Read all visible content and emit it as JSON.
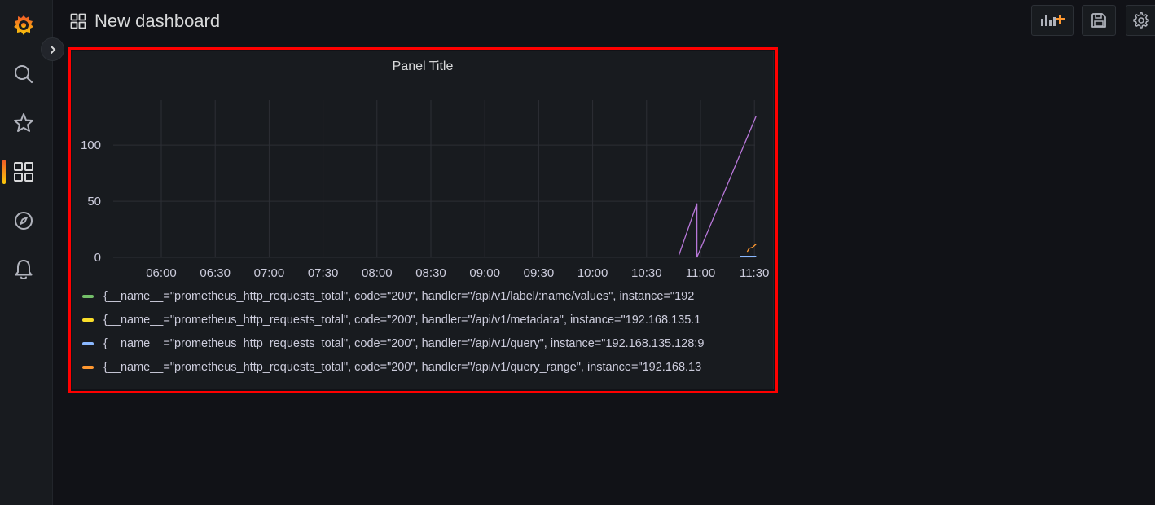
{
  "header": {
    "title": "New dashboard"
  },
  "sidebar": {
    "items": [
      {
        "name": "grafana-logo"
      },
      {
        "name": "search-icon"
      },
      {
        "name": "star-icon"
      },
      {
        "name": "dashboards-icon",
        "active": true
      },
      {
        "name": "explore-icon"
      },
      {
        "name": "alerting-icon"
      }
    ]
  },
  "toolbar": {
    "buttons": [
      "add-panel-icon",
      "save-icon",
      "settings-icon"
    ]
  },
  "colors": {
    "accent": "#f05a28",
    "highlight": "#ff0000",
    "series_purple": "#b877d9",
    "series_green": "#73bf69",
    "series_yellow": "#fade2a",
    "series_blue": "#8ab8ff",
    "series_orange": "#ff9830"
  },
  "panel": {
    "title": "Panel Title",
    "legend": [
      {
        "color": "#73bf69",
        "label": "{__name__=\"prometheus_http_requests_total\", code=\"200\", handler=\"/api/v1/label/:name/values\", instance=\"192"
      },
      {
        "color": "#fade2a",
        "label": "{__name__=\"prometheus_http_requests_total\", code=\"200\", handler=\"/api/v1/metadata\", instance=\"192.168.135.1"
      },
      {
        "color": "#8ab8ff",
        "label": "{__name__=\"prometheus_http_requests_total\", code=\"200\", handler=\"/api/v1/query\", instance=\"192.168.135.128:9"
      },
      {
        "color": "#ff9830",
        "label": "{__name__=\"prometheus_http_requests_total\", code=\"200\", handler=\"/api/v1/query_range\", instance=\"192.168.13"
      }
    ]
  },
  "chart_data": {
    "type": "line",
    "title": "Panel Title",
    "x_ticks": [
      "06:00",
      "06:30",
      "07:00",
      "07:30",
      "08:00",
      "08:30",
      "09:00",
      "09:30",
      "10:00",
      "10:30",
      "11:00",
      "11:30"
    ],
    "y_ticks": [
      0,
      50,
      100
    ],
    "ylim": [
      0,
      140
    ],
    "grid": true,
    "legend_position": "bottom",
    "series": [
      {
        "color": "#b877d9",
        "x": [
          "10:48",
          "10:58",
          "10:58",
          "11:31"
        ],
        "y": [
          2,
          48,
          0,
          126
        ]
      },
      {
        "color": "#8ab8ff",
        "x": [
          "11:22",
          "11:31"
        ],
        "y": [
          1,
          1
        ]
      },
      {
        "color": "#ff9830",
        "x": [
          "11:26",
          "11:27",
          "11:29",
          "11:31"
        ],
        "y": [
          5,
          8,
          9,
          12
        ]
      }
    ]
  }
}
